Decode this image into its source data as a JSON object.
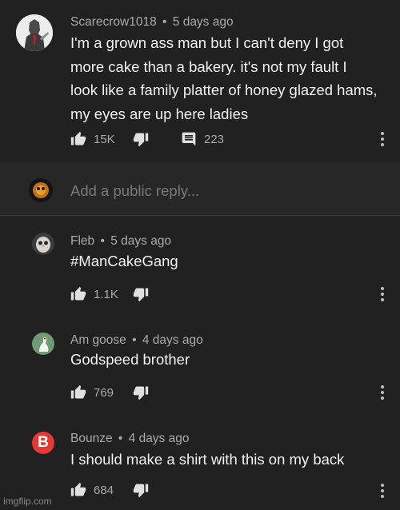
{
  "comments": [
    {
      "author": "Scarecrow1018",
      "age": "5 days ago",
      "lines": [
        "I'm a grown ass man but I can't deny I got",
        "more cake than a bakery. it's not my fault I",
        "look like a family platter of honey glazed hams,",
        "my eyes are up here ladies"
      ],
      "likes": "15K",
      "replies": "223"
    },
    {
      "author": "Fleb",
      "age": "5 days ago",
      "lines": [
        "#ManCakeGang"
      ],
      "likes": "1.1K"
    },
    {
      "author": "Am goose",
      "age": "4 days ago",
      "lines": [
        "Godspeed brother"
      ],
      "likes": "769"
    },
    {
      "author": "Bounze",
      "age": "4 days ago",
      "lines": [
        "I should make a shirt with this on my back"
      ],
      "likes": "684"
    }
  ],
  "reply_box": {
    "placeholder": "Add a public reply..."
  },
  "avatar_letter": "B",
  "meta_separator": "•",
  "watermark": "imgflip.com",
  "icons": [
    "thumbs-up-icon",
    "thumbs-down-icon",
    "comment-icon",
    "more-vert-icon"
  ],
  "colors": {
    "background": "#212121",
    "reply_area": "#272727",
    "text": "#f1f1f1",
    "muted": "#aaaaaa",
    "bounze_avatar": "#e53935"
  }
}
